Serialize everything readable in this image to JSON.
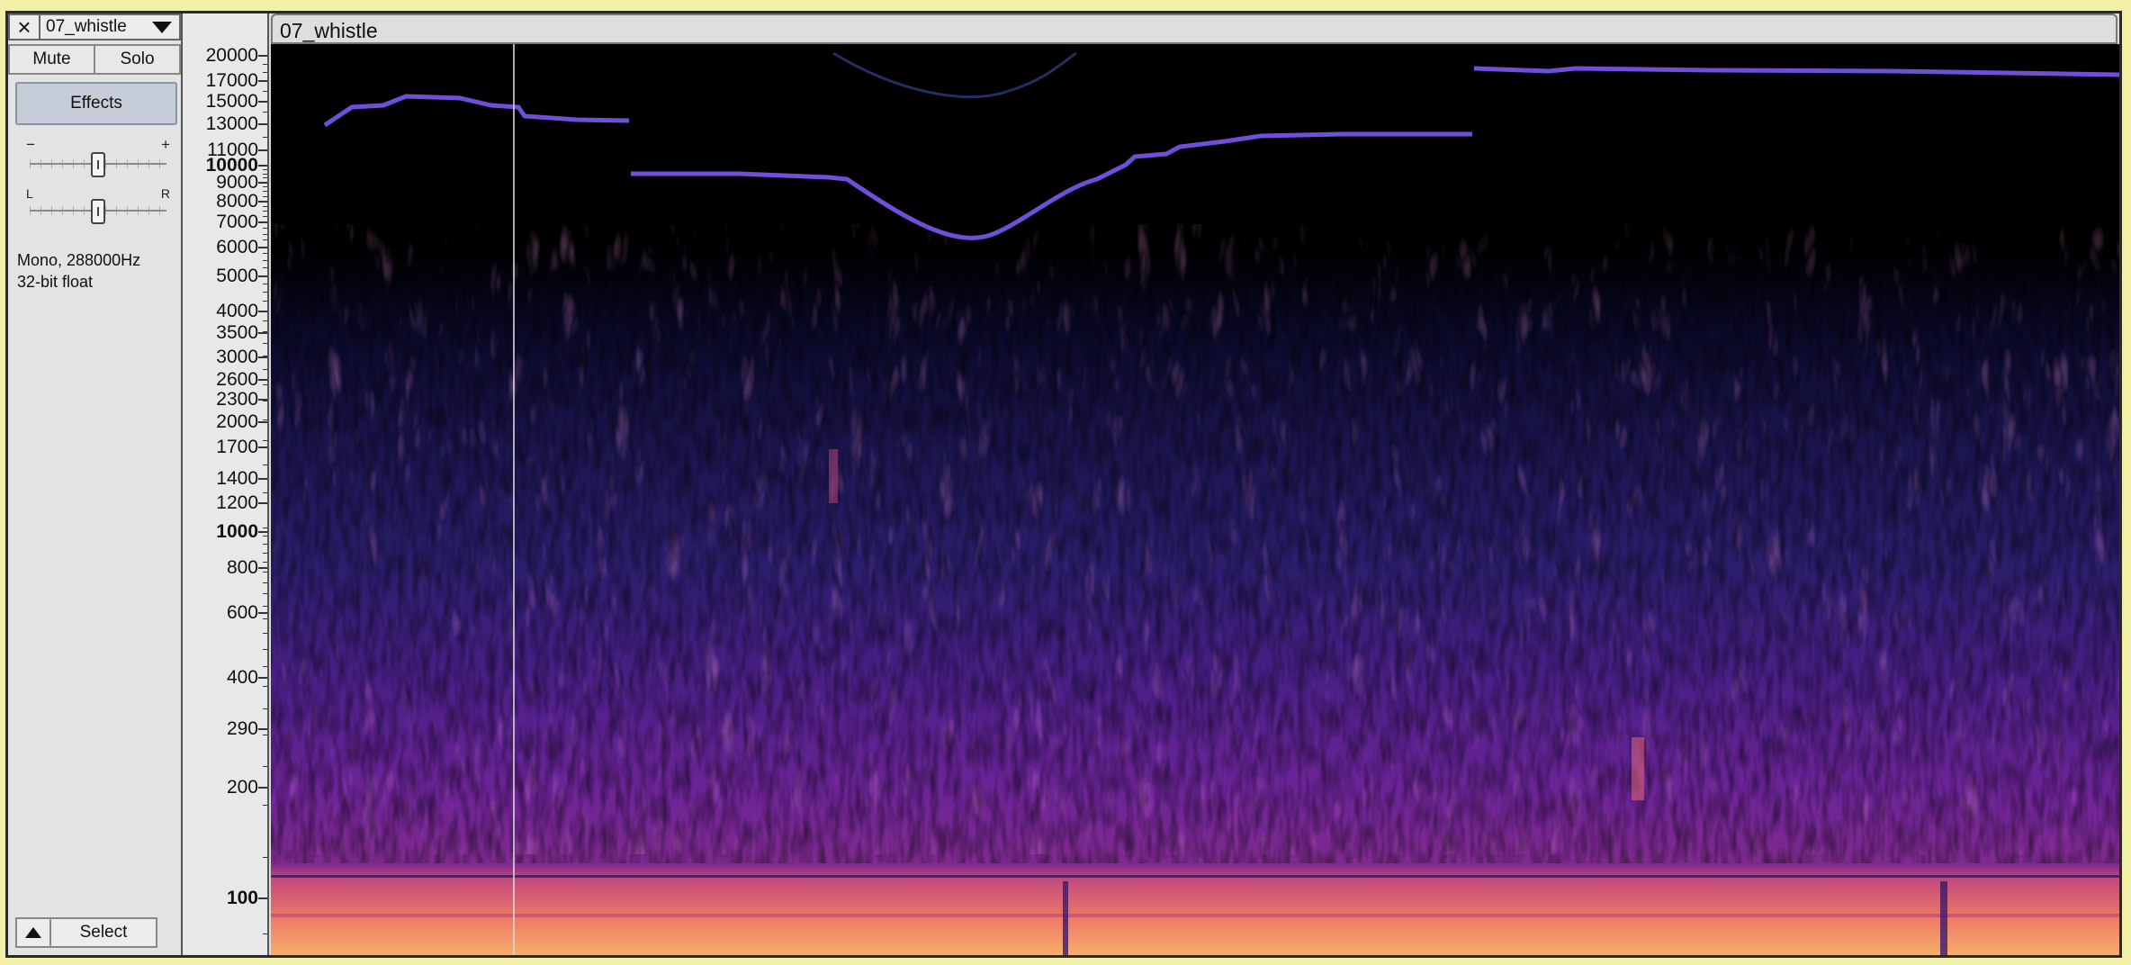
{
  "track": {
    "close_icon": "×",
    "name": "07_whistle",
    "mute_label": "Mute",
    "solo_label": "Solo",
    "effects_label": "Effects",
    "gain_minus": "−",
    "gain_plus": "+",
    "pan_left": "L",
    "pan_right": "R",
    "gain_level": 0.5,
    "pan_level": 0.5,
    "format_line1": "Mono, 288000Hz",
    "format_line2": "32-bit float",
    "select_label": "Select"
  },
  "clip": {
    "title": "07_whistle"
  },
  "ruler": {
    "scale": "logarithmic frequency (Hz)",
    "labels": [
      "20000",
      "17000",
      "15000",
      "13000",
      "11000",
      "10000",
      "9000",
      "8000",
      "7000",
      "6000",
      "5000",
      "4000",
      "3500",
      "3000",
      "2600",
      "2300",
      "2000",
      "1700",
      "1400",
      "1200",
      "1000",
      "800",
      "600",
      "400",
      "290",
      "200",
      "100"
    ],
    "bold_labels": [
      "10000",
      "1000",
      "100"
    ]
  },
  "spectrogram": {
    "colormap": "magma",
    "background": "#000000",
    "whistle_color": "#7a4fe0",
    "hot_color": "#f5a06a"
  }
}
